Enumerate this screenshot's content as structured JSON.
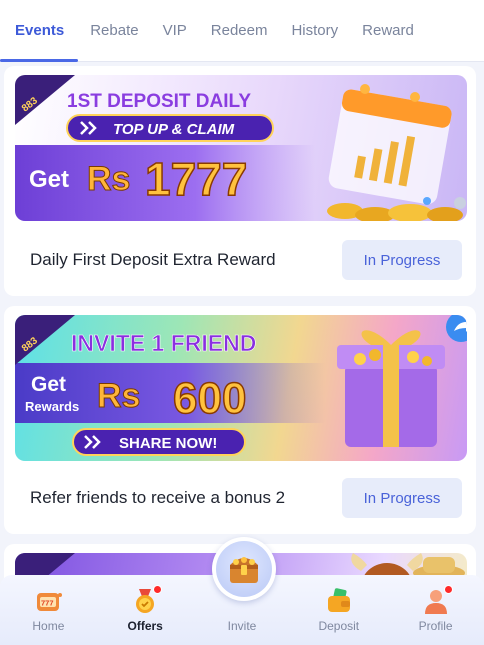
{
  "tabs": [
    {
      "label": "Events",
      "active": true
    },
    {
      "label": "Rebate"
    },
    {
      "label": "VIP"
    },
    {
      "label": "Redeem"
    },
    {
      "label": "History"
    },
    {
      "label": "Reward"
    }
  ],
  "cards": [
    {
      "banner": {
        "badge": "883",
        "headline": "1ST DEPOSIT DAILY",
        "cta": "TOP UP & CLAIM",
        "amount_prefix": "Get",
        "currency": "Rs",
        "amount": "1777"
      },
      "title": "Daily First Deposit Extra Reward",
      "status": "In Progress"
    },
    {
      "banner": {
        "badge": "883",
        "headline": "INVITE 1 FRIEND",
        "amount_prefix": "Get",
        "amount_sub": "Rewards",
        "currency": "Rs",
        "amount": "600",
        "cta": "SHARE NOW!"
      },
      "title": "Refer friends to receive a bonus 2",
      "status": "In Progress"
    }
  ],
  "bottom_nav": [
    {
      "label": "Home",
      "icon": "slot-777-icon"
    },
    {
      "label": "Offers",
      "icon": "medal-icon",
      "active": true,
      "badge_dot": true
    },
    {
      "label": "Invite",
      "icon": "treasure-chest-icon"
    },
    {
      "label": "Deposit",
      "icon": "wallet-icon"
    },
    {
      "label": "Profile",
      "icon": "user-icon",
      "badge_dot": true
    }
  ],
  "colors": {
    "accent": "#3d5ad8",
    "status_bg": "#e7ecfa",
    "badge_red": "#ff2a2a"
  }
}
